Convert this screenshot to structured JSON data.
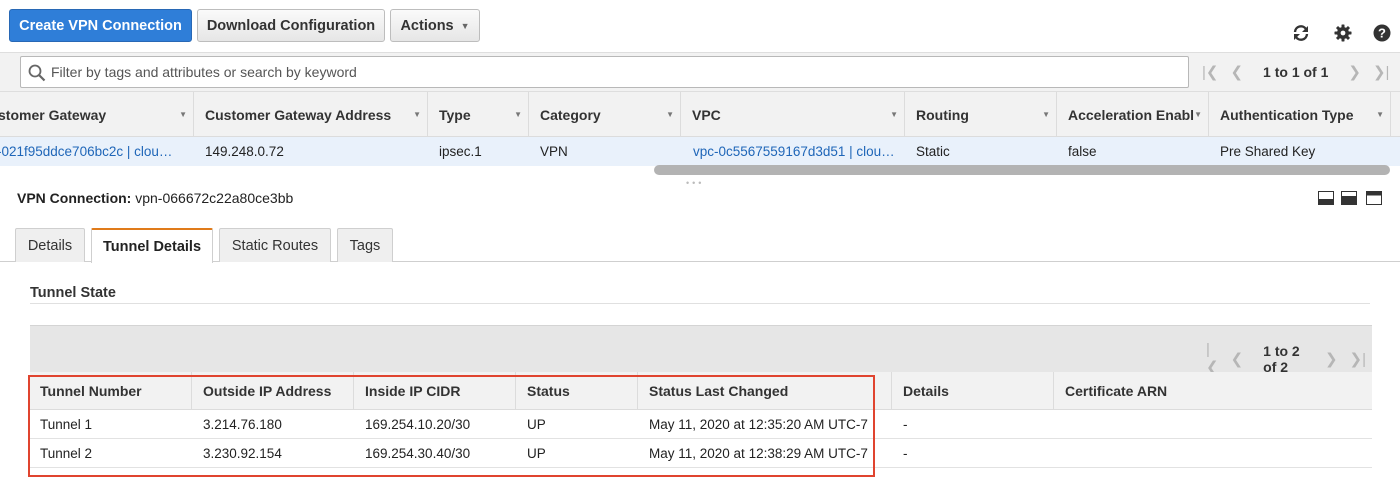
{
  "toolbar": {
    "create_label": "Create VPN Connection",
    "download_label": "Download Configuration",
    "actions_label": "Actions",
    "icons": [
      "refresh-icon",
      "gear-icon",
      "help-icon"
    ]
  },
  "filter": {
    "placeholder": "Filter by tags and attributes or search by keyword",
    "pager_text": "1 to 1 of 1"
  },
  "grid": {
    "columns": [
      "stomer Gateway",
      "Customer Gateway Address",
      "Type",
      "Category",
      "VPC",
      "Routing",
      "Acceleration Enable",
      "Authentication Type"
    ],
    "row": [
      "-021f95ddce706bc2c | clou…",
      "149.248.0.72",
      "ipsec.1",
      "VPN",
      "vpc-0c5567559167d3d51 | clou…",
      "Static",
      "false",
      "Pre Shared Key"
    ]
  },
  "detail": {
    "title_label": "VPN Connection:",
    "title_value": "vpn-066672c22a80ce3bb",
    "tabs": [
      "Details",
      "Tunnel Details",
      "Static Routes",
      "Tags"
    ],
    "active_tab": "Tunnel Details",
    "section_title": "Tunnel State",
    "pager_text": "1 to 2 of 2",
    "columns": [
      "Tunnel Number",
      "Outside IP Address",
      "Inside IP CIDR",
      "Status",
      "Status Last Changed",
      "Details",
      "Certificate ARN"
    ],
    "rows": [
      [
        "Tunnel 1",
        "3.214.76.180",
        "169.254.10.20/30",
        "UP",
        "May 11, 2020 at 12:35:20 AM UTC-7",
        "-",
        ""
      ],
      [
        "Tunnel 2",
        "3.230.92.154",
        "169.254.30.40/30",
        "UP",
        "May 11, 2020 at 12:38:29 AM UTC-7",
        "-",
        ""
      ]
    ]
  },
  "colors": {
    "primary": "#2f7ed8",
    "link": "#1f66b8",
    "active_tab_accent": "#e07b1a",
    "highlight": "#e0442f"
  }
}
